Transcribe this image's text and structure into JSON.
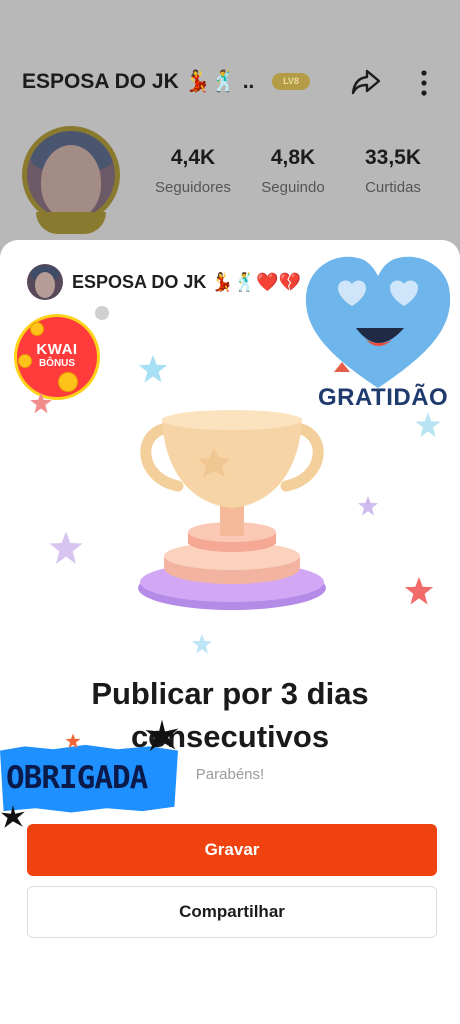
{
  "profile": {
    "name": "ESPOSA DO JK 💃🕺 ..",
    "level_badge": "LV8",
    "stats": [
      {
        "value": "4,4K",
        "label": "Seguidores"
      },
      {
        "value": "4,8K",
        "label": "Seguindo"
      },
      {
        "value": "33,5K",
        "label": "Curtidas"
      }
    ]
  },
  "sheet": {
    "name": "ESPOSA DO JK 💃🕺❤️💔",
    "title_line1": "Publicar por 3 dias",
    "title_line2": "consecutivos",
    "subtitle": "Parabéns!",
    "primary_button": "Gravar",
    "secondary_button": "Compartilhar"
  },
  "stickers": {
    "bonus_line1": "KWAI",
    "bonus_line2": "BÔNUS",
    "gratidao": "GRATIDÃO",
    "obrigada": "OBRIGADA"
  },
  "icons": [
    "share-icon",
    "more-icon",
    "trophy-icon",
    "heart-eyes-icon",
    "star-icon"
  ],
  "colors": {
    "accent": "#f0420f",
    "overlay": "#b8b8b8",
    "heart": "#6db5ea",
    "obrigada_bg": "#1e90ff"
  }
}
